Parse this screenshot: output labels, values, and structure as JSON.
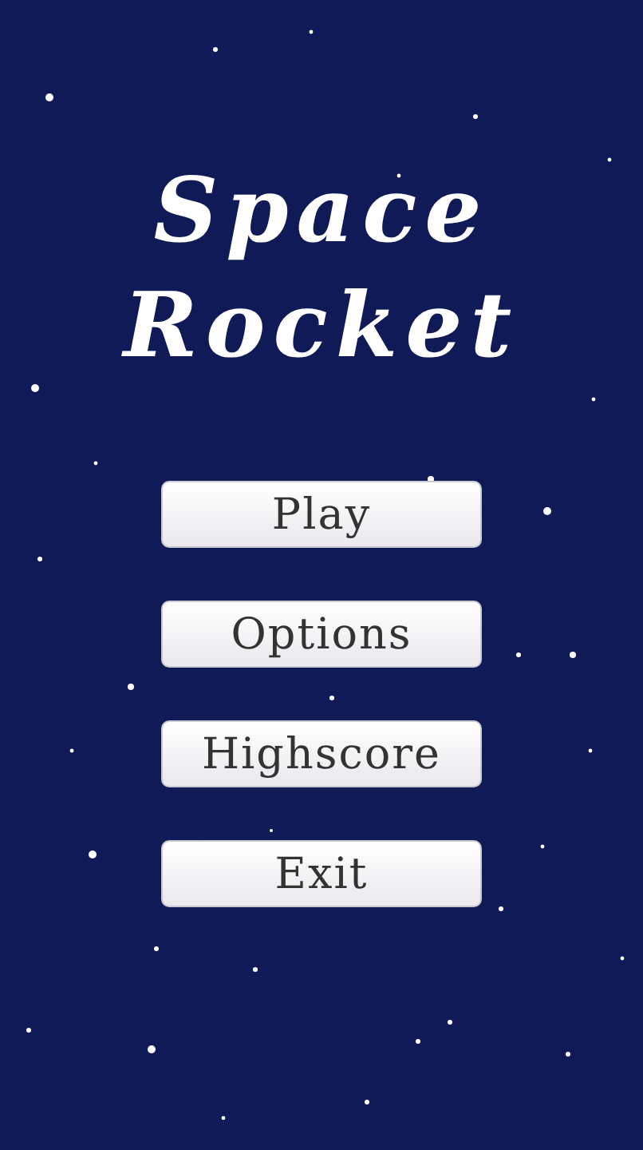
{
  "title": [
    "Space",
    "Rocket"
  ],
  "menu": [
    "Play",
    "Options",
    "Highscore",
    "Exit"
  ]
}
